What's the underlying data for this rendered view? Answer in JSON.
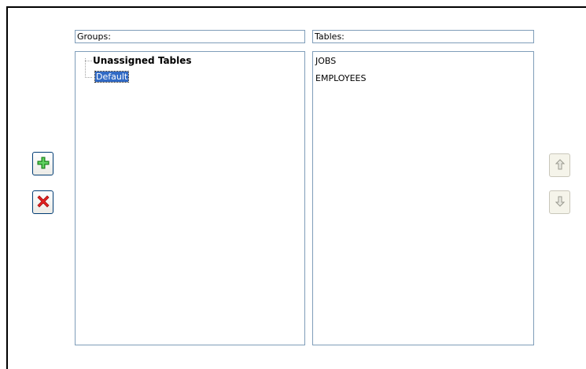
{
  "groups": {
    "header_label": "Groups:",
    "tree": {
      "root_label": "Unassigned Tables",
      "child_label": "Default"
    }
  },
  "tables": {
    "header_label": "Tables:",
    "items": [
      "JOBS",
      "EMPLOYEES"
    ]
  },
  "buttons": {
    "add_icon": "plus-icon",
    "delete_icon": "delete-x-icon",
    "move_up_icon": "arrow-up-icon",
    "move_down_icon": "arrow-down-icon"
  },
  "colors": {
    "selection": "#316ac5",
    "border": "#7f9db9",
    "add_green": "#2e9e2e",
    "delete_red": "#e02020"
  }
}
